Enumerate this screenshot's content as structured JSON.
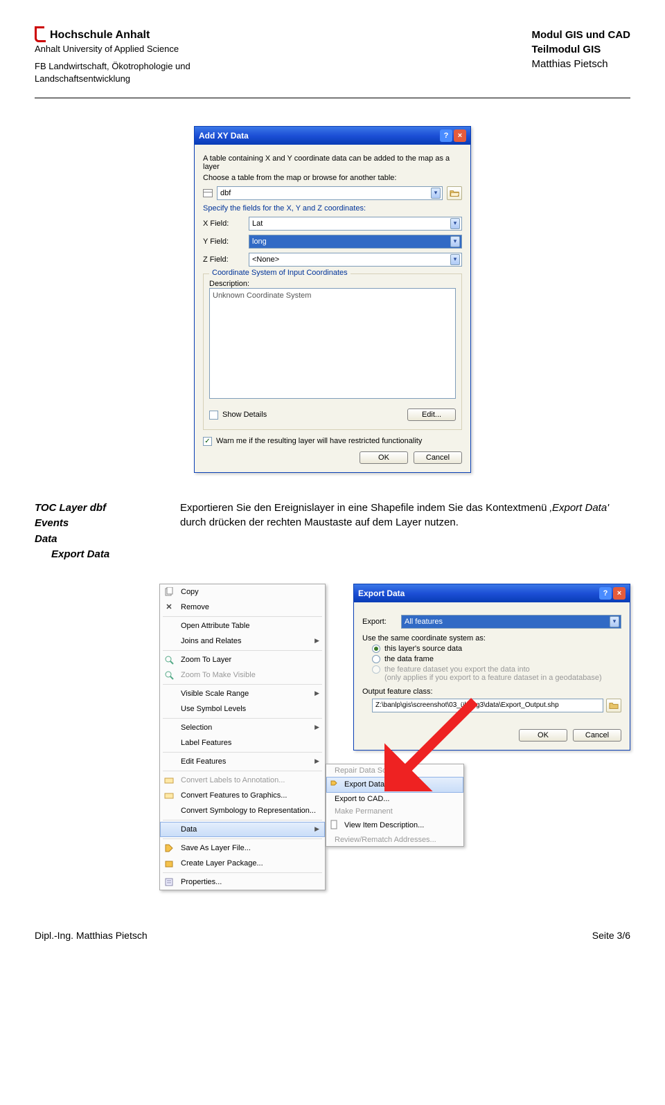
{
  "header": {
    "institution_bold": "Hochschule Anhalt",
    "institution_sub": "Anhalt University of Applied Science",
    "faculty1": "FB Landwirtschaft, Ökotrophologie und",
    "faculty2": "Landschaftsentwicklung",
    "module1": "Modul GIS und CAD",
    "module2": "Teilmodul GIS",
    "author": "Matthias Pietsch"
  },
  "addxy": {
    "title": "Add XY Data",
    "intro": "A table containing X and Y coordinate data can be added to the map as a layer",
    "choose": "Choose a table from the map or browse for another table:",
    "table_value": "dbf",
    "specify": "Specify the fields for the X, Y and Z coordinates:",
    "x_label": "X Field:",
    "x_value": "Lat",
    "y_label": "Y Field:",
    "y_value": "long",
    "z_label": "Z Field:",
    "z_value": "<None>",
    "coord_legend": "Coordinate System of Input Coordinates",
    "desc_label": "Description:",
    "desc_value": "Unknown Coordinate System",
    "show_details": "Show Details",
    "edit_btn": "Edit...",
    "warn_label": "Warn me if the resulting layer will have restricted functionality",
    "ok": "OK",
    "cancel": "Cancel"
  },
  "toc": {
    "l1": "TOC Layer dbf",
    "l2a": "Events",
    "l2b": "Data",
    "l3": "Export Data"
  },
  "description": {
    "p1a": "Exportieren Sie den Ereignislayer in eine Shapefile indem Sie das Kontextmenü ",
    "em": "‚Export Data'",
    "p1b": " durch drücken der rechten Maustaste auf dem Layer nutzen."
  },
  "context_menu": {
    "items": [
      {
        "label": "Copy",
        "icon": "copy",
        "sub": false,
        "disabled": false
      },
      {
        "label": "Remove",
        "icon": "remove",
        "sub": false,
        "disabled": false
      },
      {
        "label": "Open Attribute Table",
        "icon": "",
        "sub": false,
        "disabled": false,
        "sep_before": true
      },
      {
        "label": "Joins and Relates",
        "icon": "",
        "sub": true,
        "disabled": false
      },
      {
        "label": "Zoom To Layer",
        "icon": "zoom",
        "sub": false,
        "disabled": false,
        "sep_before": true
      },
      {
        "label": "Zoom To Make Visible",
        "icon": "zoom",
        "sub": false,
        "disabled": true
      },
      {
        "label": "Visible Scale Range",
        "icon": "",
        "sub": true,
        "disabled": false,
        "sep_before": true
      },
      {
        "label": "Use Symbol Levels",
        "icon": "",
        "sub": false,
        "disabled": false
      },
      {
        "label": "Selection",
        "icon": "",
        "sub": true,
        "disabled": false,
        "sep_before": true
      },
      {
        "label": "Label Features",
        "icon": "",
        "sub": false,
        "disabled": false
      },
      {
        "label": "Edit Features",
        "icon": "",
        "sub": true,
        "disabled": false,
        "sep_before": true
      },
      {
        "label": "Convert Labels to Annotation...",
        "icon": "convert",
        "sub": false,
        "disabled": true,
        "sep_before": true
      },
      {
        "label": "Convert Features to Graphics...",
        "icon": "convert",
        "sub": false,
        "disabled": false
      },
      {
        "label": "Convert Symbology to Representation...",
        "icon": "",
        "sub": false,
        "disabled": false
      },
      {
        "label": "Data",
        "icon": "",
        "sub": true,
        "disabled": false,
        "hl": true,
        "sep_before": true
      },
      {
        "label": "Save As Layer File...",
        "icon": "save",
        "sub": false,
        "disabled": false,
        "sep_before": true
      },
      {
        "label": "Create Layer Package...",
        "icon": "package",
        "sub": false,
        "disabled": false
      },
      {
        "label": "Properties...",
        "icon": "props",
        "sub": false,
        "disabled": false,
        "sep_before": true
      }
    ]
  },
  "submenu": {
    "items": [
      {
        "label": "Repair Data Source...",
        "disabled": true
      },
      {
        "label": "Export Data...",
        "hl": true,
        "icon": "export"
      },
      {
        "label": "Export to CAD...",
        "disabled": false
      },
      {
        "label": "Make Permanent",
        "disabled": true
      },
      {
        "label": "View Item Description...",
        "disabled": false,
        "icon": "doc"
      },
      {
        "label": "Review/Rematch Addresses...",
        "disabled": true
      }
    ]
  },
  "exportdlg": {
    "title": "Export Data",
    "export_lbl": "Export:",
    "export_val": "All features",
    "use_same": "Use the same coordinate system as:",
    "r1": "this layer's source data",
    "r2": "the data frame",
    "r3": "the feature dataset you export the data into",
    "r3b": "(only applies if you export to a feature dataset in a geodatabase)",
    "out_lbl": "Output feature class:",
    "out_path": "Z:\\banlp\\gis\\screenshot\\03_übung3\\data\\Export_Output.shp",
    "ok": "OK",
    "cancel": "Cancel"
  },
  "footer": {
    "left": "Dipl.-Ing. Matthias Pietsch",
    "right": "Seite 3/6"
  }
}
